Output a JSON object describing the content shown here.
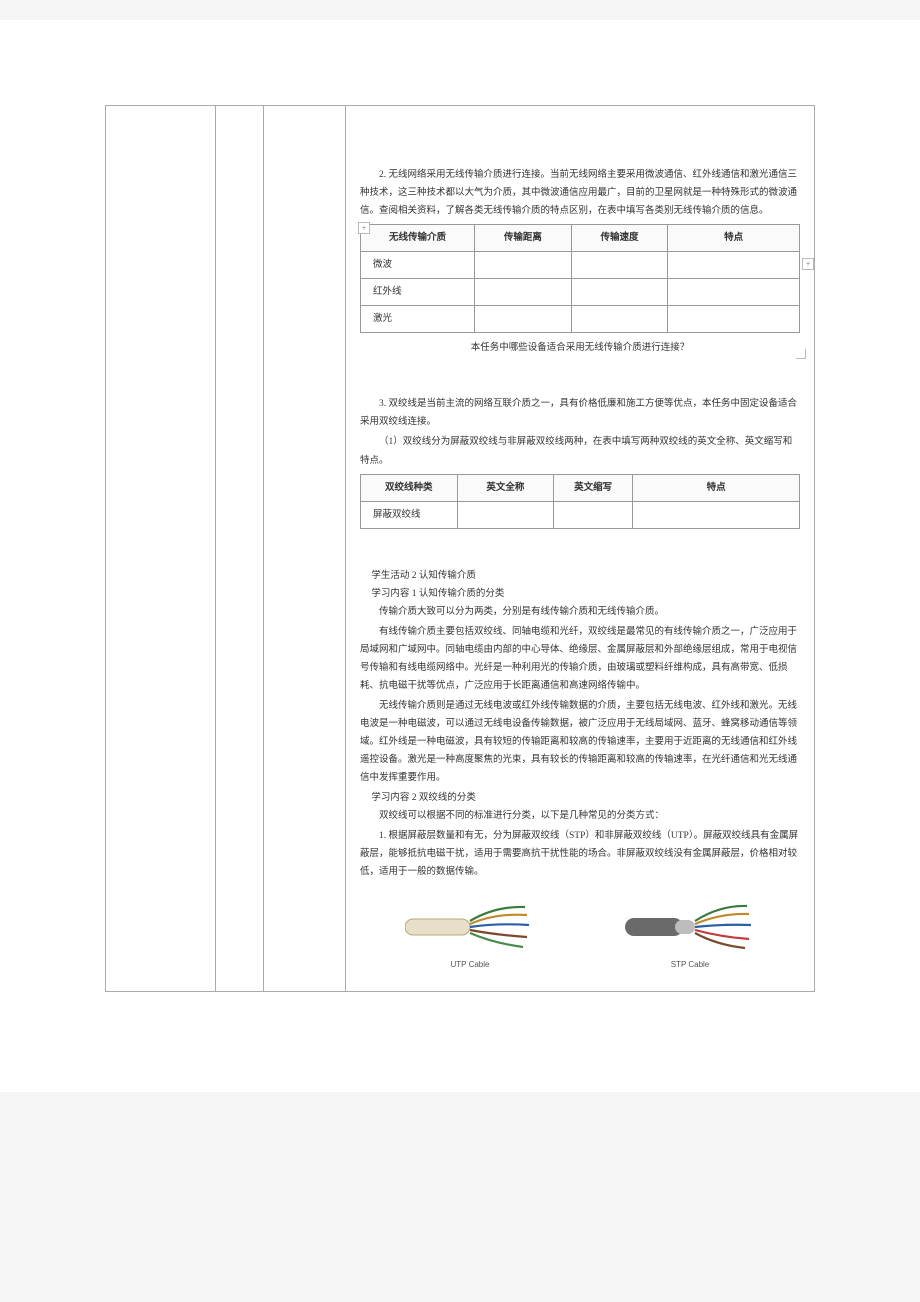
{
  "section1": {
    "intro": "2. 无线网络采用无线传输介质进行连接。当前无线网络主要采用微波通信、红外线通信和激光通信三种技术，这三种技术都以大气为介质，其中微波通信应用最广，目前的卫星网就是一种特殊形式的微波通信。查阅相关资料，了解各类无线传输介质的特点区别，在表中填写各类别无线传输介质的信息。",
    "table_headers": [
      "无线传输介质",
      "传输距离",
      "传输速度",
      "特点"
    ],
    "rows": [
      "微波",
      "红外线",
      "激光"
    ],
    "caption": "本任务中哪些设备适合采用无线传输介质进行连接？"
  },
  "section2": {
    "intro": "3. 双绞线是当前主流的网络互联介质之一，具有价格低廉和施工方便等优点，本任务中固定设备适合采用双绞线连接。",
    "sub1": "（1）双绞线分为屏蔽双绞线与非屏蔽双绞线两种，在表中填写两种双绞线的英文全称、英文缩写和特点。",
    "table_headers": [
      "双绞线种类",
      "英文全称",
      "英文缩写",
      "特点"
    ],
    "rows": [
      "屏蔽双绞线"
    ]
  },
  "activity": {
    "title": "学生活动 2 认知传输介质",
    "sub1_title": "学习内容 1 认知传输介质的分类",
    "p1": "传输介质大致可以分为两类，分别是有线传输介质和无线传输介质。",
    "p2": "有线传输介质主要包括双绞线、同轴电缆和光纤，双绞线是最常见的有线传输介质之一，广泛应用于局域网和广域网中。同轴电缆由内部的中心导体、绝缘层、金属屏蔽层和外部绝缘层组成，常用于电视信号传输和有线电缆网络中。光纤是一种利用光的传输介质，由玻璃或塑料纤维构成，具有高带宽、低损耗、抗电磁干扰等优点，广泛应用于长距离通信和高速网络传输中。",
    "p3": "无线传输介质则是通过无线电波或红外线传输数据的介质，主要包括无线电波、红外线和激光。无线电波是一种电磁波，可以通过无线电设备传输数据，被广泛应用于无线局域网、蓝牙、蜂窝移动通信等领域。红外线是一种电磁波，具有较短的传输距离和较高的传输速率，主要用于近距离的无线通信和红外线遥控设备。激光是一种高度聚焦的光束，具有较长的传输距离和较高的传输速率，在光纤通信和光无线通信中发挥重要作用。",
    "sub2_title": "学习内容 2 双绞线的分类",
    "p4": "双绞线可以根据不同的标准进行分类，以下是几种常见的分类方式：",
    "p5": "1. 根据屏蔽层数量和有无，分为屏蔽双绞线（STP）和非屏蔽双绞线（UTP）。屏蔽双绞线具有金属屏蔽层，能够抵抗电磁干扰，适用于需要高抗干扰性能的场合。非屏蔽双绞线没有金属屏蔽层，价格相对较低，适用于一般的数据传输。"
  },
  "cables": {
    "utp": "UTP Cable",
    "stp": "STP Cable"
  }
}
